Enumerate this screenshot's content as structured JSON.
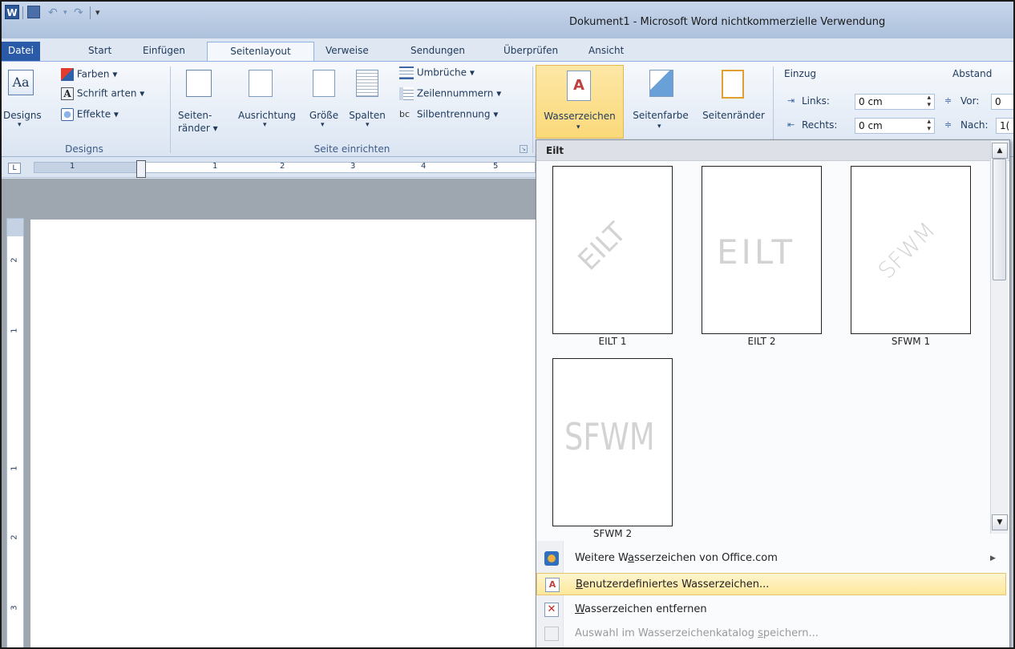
{
  "window": {
    "title": "Dokument1  -  Microsoft Word nichtkommerzielle Verwendung"
  },
  "tabs": [
    {
      "label": "Datei"
    },
    {
      "label": "Start"
    },
    {
      "label": "Einfügen"
    },
    {
      "label": "Seitenlayout"
    },
    {
      "label": "Verweise"
    },
    {
      "label": "Sendungen"
    },
    {
      "label": "Überprüfen"
    },
    {
      "label": "Ansicht"
    }
  ],
  "ribbon": {
    "designs": {
      "group_label": "Designs",
      "designs_button": "Designs",
      "farben": "Farben ▾",
      "schriftarten": "Schrift arten ▾",
      "effekte": "Effekte ▾"
    },
    "seite_einrichten": {
      "group_label": "Seite einrichten",
      "seitenraender_line1": "Seiten-",
      "seitenraender_line2": "ränder ▾",
      "ausrichtung": "Ausrichtung",
      "groesse": "Größe",
      "spalten": "Spalten",
      "umbrueche": "Umbrüche ▾",
      "zeilennummern": "Zeilennummern ▾",
      "silbentrennung": "Silbentrennung ▾"
    },
    "seitenhintergrund": {
      "wasserzeichen": "Wasserzeichen",
      "seitenfarbe": "Seitenfarbe",
      "seitenraender": "Seitenränder"
    },
    "absatz": {
      "einzug": "Einzug",
      "links_label": "Links:",
      "links_value": "0 cm",
      "rechts_label": "Rechts:",
      "rechts_value": "0 cm",
      "abstand": "Abstand",
      "vor_label": "Vor:",
      "vor_value": "0",
      "nach_label": "Nach:",
      "nach_value": "1("
    }
  },
  "ruler": {
    "numbers": [
      "1",
      "1",
      "2",
      "3",
      "4",
      "5"
    ]
  },
  "vruler": {
    "numbers": [
      "2",
      "1",
      "1",
      "2",
      "3"
    ]
  },
  "dropdown": {
    "header": "Eilt",
    "thumbnails": [
      {
        "label": "EILT 1",
        "watermark": "EILT"
      },
      {
        "label": "EILT 2",
        "watermark": "EILT"
      },
      {
        "label": "SFWM 1",
        "watermark": "SFWM"
      },
      {
        "label": "SFWM 2",
        "watermark": "SFWM"
      }
    ],
    "menu": [
      {
        "pre": "Weitere W",
        "u": "a",
        "post": "sserzeichen von Office.com"
      },
      {
        "pre": "",
        "u": "B",
        "post": "enutzerdefiniertes Wasserzeichen..."
      },
      {
        "pre": "",
        "u": "W",
        "post": "asserzeichen entfernen"
      },
      {
        "pre": "Auswahl im Wasserzeichenkatalog ",
        "u": "s",
        "post": "peichern..."
      }
    ]
  }
}
